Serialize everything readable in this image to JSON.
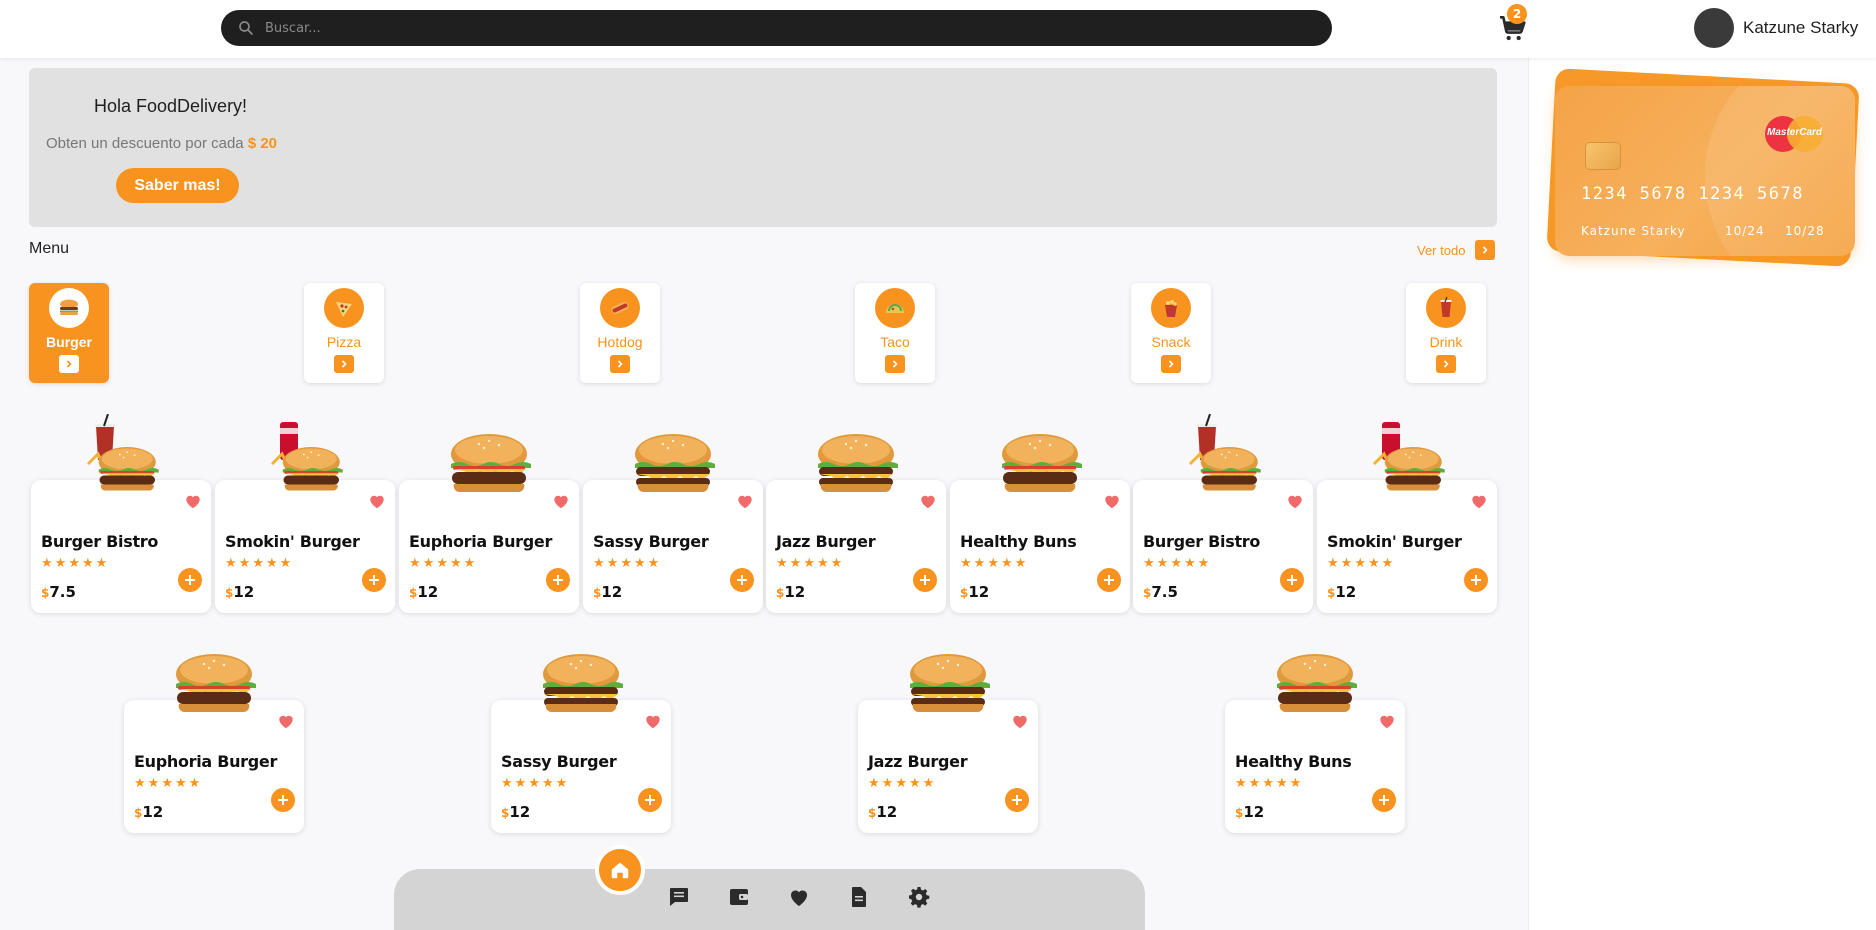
{
  "header": {
    "search_placeholder": "Buscar...",
    "cart_count": "2",
    "user_name": "Katzune Starky"
  },
  "banner": {
    "title": "Hola FoodDelivery!",
    "text": "Obten un descuento por cada",
    "amount": "$ 20",
    "button": "Saber mas!"
  },
  "menu": {
    "title": "Menu",
    "see_all": "Ver todo"
  },
  "categories": [
    {
      "label": "Burger",
      "icon": "burger-icon",
      "active": true
    },
    {
      "label": "Pizza",
      "icon": "pizza-icon"
    },
    {
      "label": "Hotdog",
      "icon": "hotdog-icon"
    },
    {
      "label": "Taco",
      "icon": "taco-icon"
    },
    {
      "label": "Snack",
      "icon": "snack-icon"
    },
    {
      "label": "Drink",
      "icon": "drink-icon"
    }
  ],
  "products": [
    {
      "name": "Burger Bistro",
      "price": "7.5"
    },
    {
      "name": "Smokin' Burger",
      "price": "12"
    },
    {
      "name": "Euphoria Burger",
      "price": "12"
    },
    {
      "name": "Sassy Burger",
      "price": "12"
    },
    {
      "name": "Jazz Burger",
      "price": "12"
    },
    {
      "name": "Healthy Buns",
      "price": "12"
    },
    {
      "name": "Burger Bistro",
      "price": "7.5"
    },
    {
      "name": "Smokin' Burger",
      "price": "12"
    },
    {
      "name": "Euphoria Burger",
      "price": "12"
    },
    {
      "name": "Sassy Burger",
      "price": "12"
    },
    {
      "name": "Jazz Burger",
      "price": "12"
    },
    {
      "name": "Healthy Buns",
      "price": "12"
    }
  ],
  "currency_symbol": "$",
  "card": {
    "number": "1234 5678 1234 5678",
    "holder": "Katzune Starky",
    "date1": "10/24",
    "date2": "10/28",
    "brand": "MasterCard"
  },
  "bottom_nav": [
    "home-icon",
    "chat-icon",
    "wallet-icon",
    "heart-icon",
    "document-icon",
    "settings-icon"
  ],
  "colors": {
    "accent": "#f7931e",
    "search_bg": "#1f1f1f",
    "banner_bg": "#e1e1e1",
    "fav": "#f06a6a"
  }
}
